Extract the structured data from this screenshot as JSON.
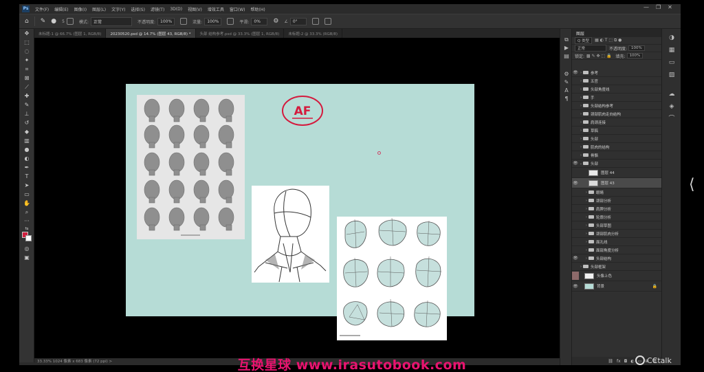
{
  "menu": {
    "logo": "Ps",
    "items": [
      "文件(F)",
      "编辑(E)",
      "图像(I)",
      "图层(L)",
      "文字(Y)",
      "选择(S)",
      "滤镜(T)",
      "3D(D)",
      "视图(V)",
      "增效工具",
      "窗口(W)",
      "帮助(H)"
    ]
  },
  "window_controls": {
    "minimize": "—",
    "restore": "❐",
    "close": "✕"
  },
  "options": {
    "mode_label": "模式:",
    "mode_value": "正常",
    "opacity_label": "不透明度:",
    "opacity_value": "100%",
    "flow_label": "流量:",
    "flow_value": "100%",
    "smooth_label": "平滑:",
    "smooth_value": "0%",
    "angle_value": "0°",
    "brush_size": "5"
  },
  "tabs": [
    {
      "label": "未标题-1 @ 66.7% (图层 1, RGB/8)",
      "active": false
    },
    {
      "label": "20230520.psd @ 14.7% (图层 43, RGB/8) *",
      "active": true
    },
    {
      "label": "头部 结构参考.psd @ 33.3% (图层 1, RGB/8)",
      "active": false
    },
    {
      "label": "未标题-2 @ 33.3% (RGB/8)",
      "active": false
    }
  ],
  "status": {
    "text": "33.33%    1024 像素 x 683 像素 (72 ppi)    >"
  },
  "canvas": {
    "background": "#b6dcd6",
    "logo_text": "AF",
    "logo_color": "#d41a3d"
  },
  "layers_panel": {
    "tab_label": "图层",
    "search_kind": "Q 类型",
    "blend_mode": "正常",
    "opacity_label": "不透明度:",
    "opacity_value": "100%",
    "lock_label": "锁定:",
    "fill_label": "填充:",
    "fill_value": "100%",
    "layers": [
      {
        "name": "参考",
        "type": "folder",
        "visible": true,
        "indent": 0,
        "selected": false
      },
      {
        "name": "五官",
        "type": "folder",
        "visible": false,
        "indent": 0,
        "selected": false
      },
      {
        "name": "头部角度线",
        "type": "folder",
        "visible": false,
        "indent": 0,
        "selected": false
      },
      {
        "name": "手",
        "type": "folder",
        "visible": false,
        "indent": 0,
        "selected": false
      },
      {
        "name": "头部结构参考",
        "type": "folder",
        "visible": false,
        "indent": 0,
        "selected": false
      },
      {
        "name": "颈部肌肉走向结构",
        "type": "folder",
        "visible": false,
        "indent": 0,
        "selected": false
      },
      {
        "name": "肩颈连接",
        "type": "folder",
        "visible": false,
        "indent": 0,
        "selected": false
      },
      {
        "name": "草稿",
        "type": "folder",
        "visible": false,
        "indent": 0,
        "selected": false
      },
      {
        "name": "头部",
        "type": "folder",
        "visible": false,
        "indent": 0,
        "selected": false
      },
      {
        "name": "肌肉的结构",
        "type": "folder",
        "visible": false,
        "indent": 0,
        "selected": false
      },
      {
        "name": "骨骼",
        "type": "folder",
        "visible": false,
        "indent": 0,
        "selected": false
      },
      {
        "name": "头部",
        "type": "folder-open",
        "visible": true,
        "indent": 0,
        "selected": false
      },
      {
        "name": "图层 44",
        "type": "layer",
        "visible": false,
        "indent": 1,
        "selected": false
      },
      {
        "name": "图层 43",
        "type": "layer",
        "visible": true,
        "indent": 1,
        "selected": true
      },
      {
        "name": "眼睛",
        "type": "folder",
        "visible": false,
        "indent": 1,
        "selected": false
      },
      {
        "name": "颈部分析",
        "type": "folder",
        "visible": false,
        "indent": 1,
        "selected": false
      },
      {
        "name": "肩胛分析",
        "type": "folder",
        "visible": false,
        "indent": 1,
        "selected": false
      },
      {
        "name": "轮廓分析",
        "type": "folder",
        "visible": false,
        "indent": 1,
        "selected": false
      },
      {
        "name": "头部草图",
        "type": "folder",
        "visible": false,
        "indent": 1,
        "selected": false
      },
      {
        "name": "颈部肌肉分析",
        "type": "folder",
        "visible": false,
        "indent": 1,
        "selected": false
      },
      {
        "name": "面孔线",
        "type": "folder",
        "visible": false,
        "indent": 1,
        "selected": false
      },
      {
        "name": "面部角度分析",
        "type": "folder",
        "visible": false,
        "indent": 1,
        "selected": false
      },
      {
        "name": "头部结构",
        "type": "folder",
        "visible": true,
        "indent": 1,
        "selected": false
      },
      {
        "name": "头部框架",
        "type": "folder",
        "visible": false,
        "indent": 0,
        "selected": false
      },
      {
        "name": "头像上色",
        "type": "layer",
        "visible": false,
        "indent": 0,
        "selected": false
      },
      {
        "name": "背景",
        "type": "bg",
        "visible": true,
        "indent": 0,
        "selected": false
      }
    ],
    "footer_icons": [
      "link-icon",
      "fx-icon",
      "mask-icon",
      "adjust-icon",
      "folder-icon",
      "new-layer-icon",
      "trash-icon"
    ]
  },
  "overlay": {
    "watermark": "互换星球 www.irasutobook.com",
    "cctalk": "CCtalk"
  }
}
